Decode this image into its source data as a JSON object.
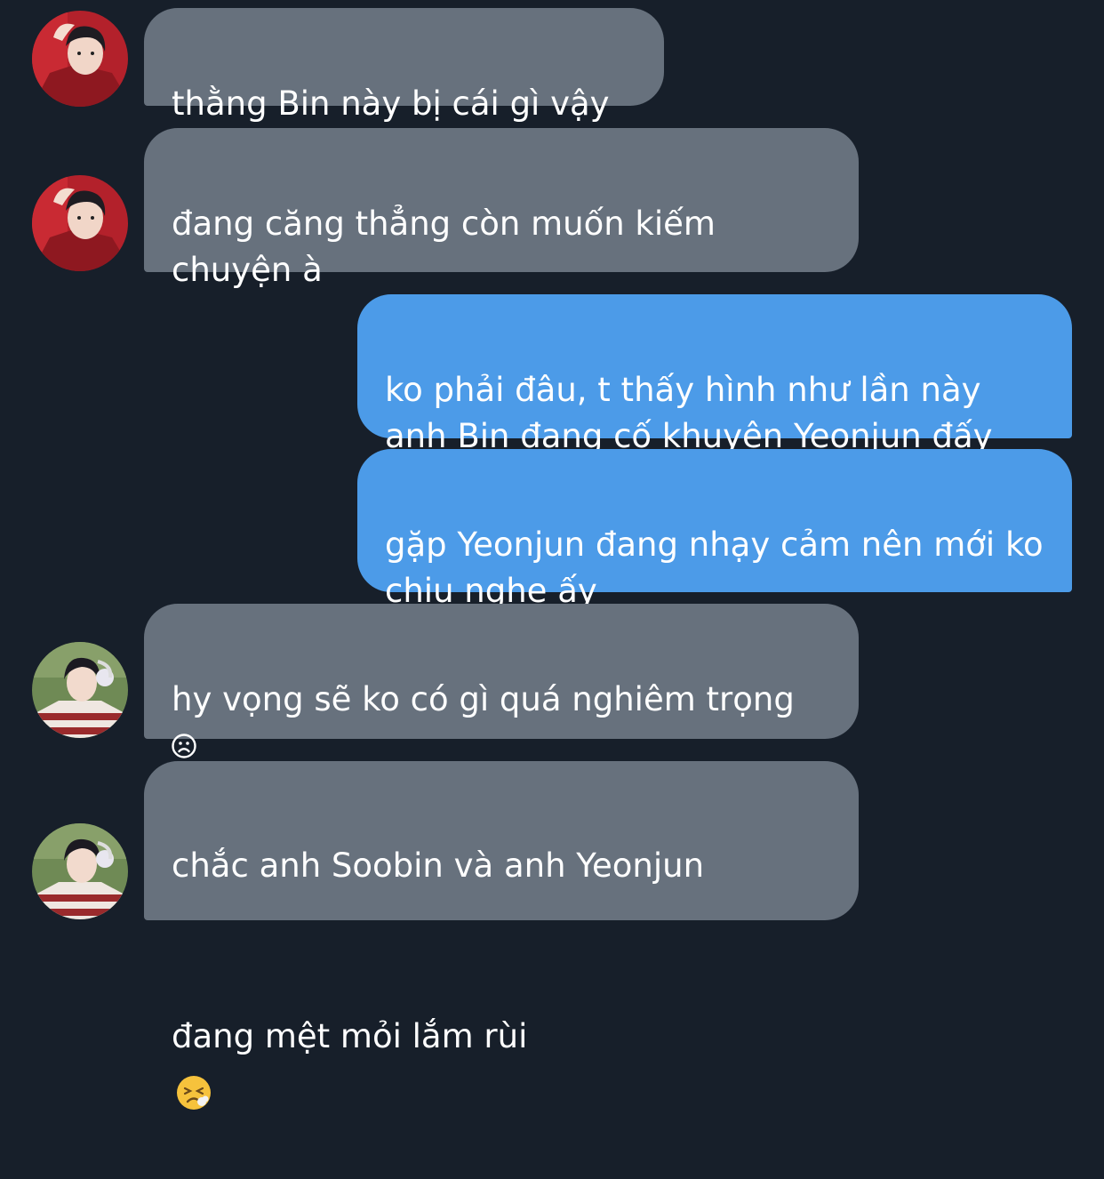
{
  "messages": [
    {
      "id": 1,
      "side": "incoming",
      "avatar": "avatar-red-outfit",
      "text": "thằng Bin này bị cái gì vậy"
    },
    {
      "id": 2,
      "side": "incoming",
      "avatar": "avatar-red-outfit",
      "text": "đang căng thẳng còn muốn kiếm chuyện à"
    },
    {
      "id": 3,
      "side": "outgoing",
      "text": "ko phải đâu, t thấy hình như lần này anh Bin đang cố khuyên Yeonjun đấy"
    },
    {
      "id": 4,
      "side": "outgoing",
      "text": "gặp Yeonjun đang nhạy cảm nên mới ko chịu nghe ấy"
    },
    {
      "id": 5,
      "side": "incoming",
      "avatar": "avatar-striped-sweater",
      "text": "hy vọng sẽ ko có gì quá nghiêm trọng",
      "emoji": "frowning-face-icon"
    },
    {
      "id": 6,
      "side": "incoming",
      "avatar": "avatar-striped-sweater",
      "text_line1": "chắc anh Soobin và anh Yeonjun",
      "text_line2": "đang mệt mỏi lắm rùi",
      "emoji": "tired-face-icon"
    }
  ],
  "colors": {
    "background": "#171f2a",
    "incoming_bubble": "#67717d",
    "outgoing_bubble": "#4c9be8",
    "text": "#ffffff"
  }
}
